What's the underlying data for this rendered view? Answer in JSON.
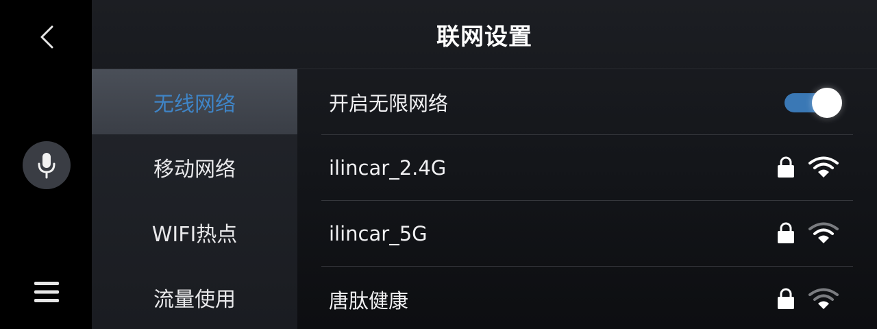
{
  "header": {
    "title": "联网设置"
  },
  "rail": {
    "back_icon": "chevron-left-icon",
    "mic_icon": "microphone-icon",
    "menu_icon": "hamburger-menu-icon"
  },
  "categories": [
    {
      "label": "无线网络",
      "active": true
    },
    {
      "label": "移动网络",
      "active": false
    },
    {
      "label": "WIFI热点",
      "active": false
    },
    {
      "label": "流量使用",
      "active": false
    }
  ],
  "wifi_toggle": {
    "label": "开启无限网络",
    "on": true
  },
  "networks": [
    {
      "ssid": "ilincar_2.4G",
      "locked": true,
      "signal_bars": 3
    },
    {
      "ssid": "ilincar_5G",
      "locked": true,
      "signal_bars": 2
    },
    {
      "ssid": "唐肽健康",
      "locked": true,
      "signal_bars": 1
    }
  ],
  "colors": {
    "accent": "#3f84c6",
    "toggle_on": "#3a78b5",
    "text": "#f0f0f2",
    "signal_active": "#ffffff",
    "signal_inactive": "#7a7c80"
  }
}
